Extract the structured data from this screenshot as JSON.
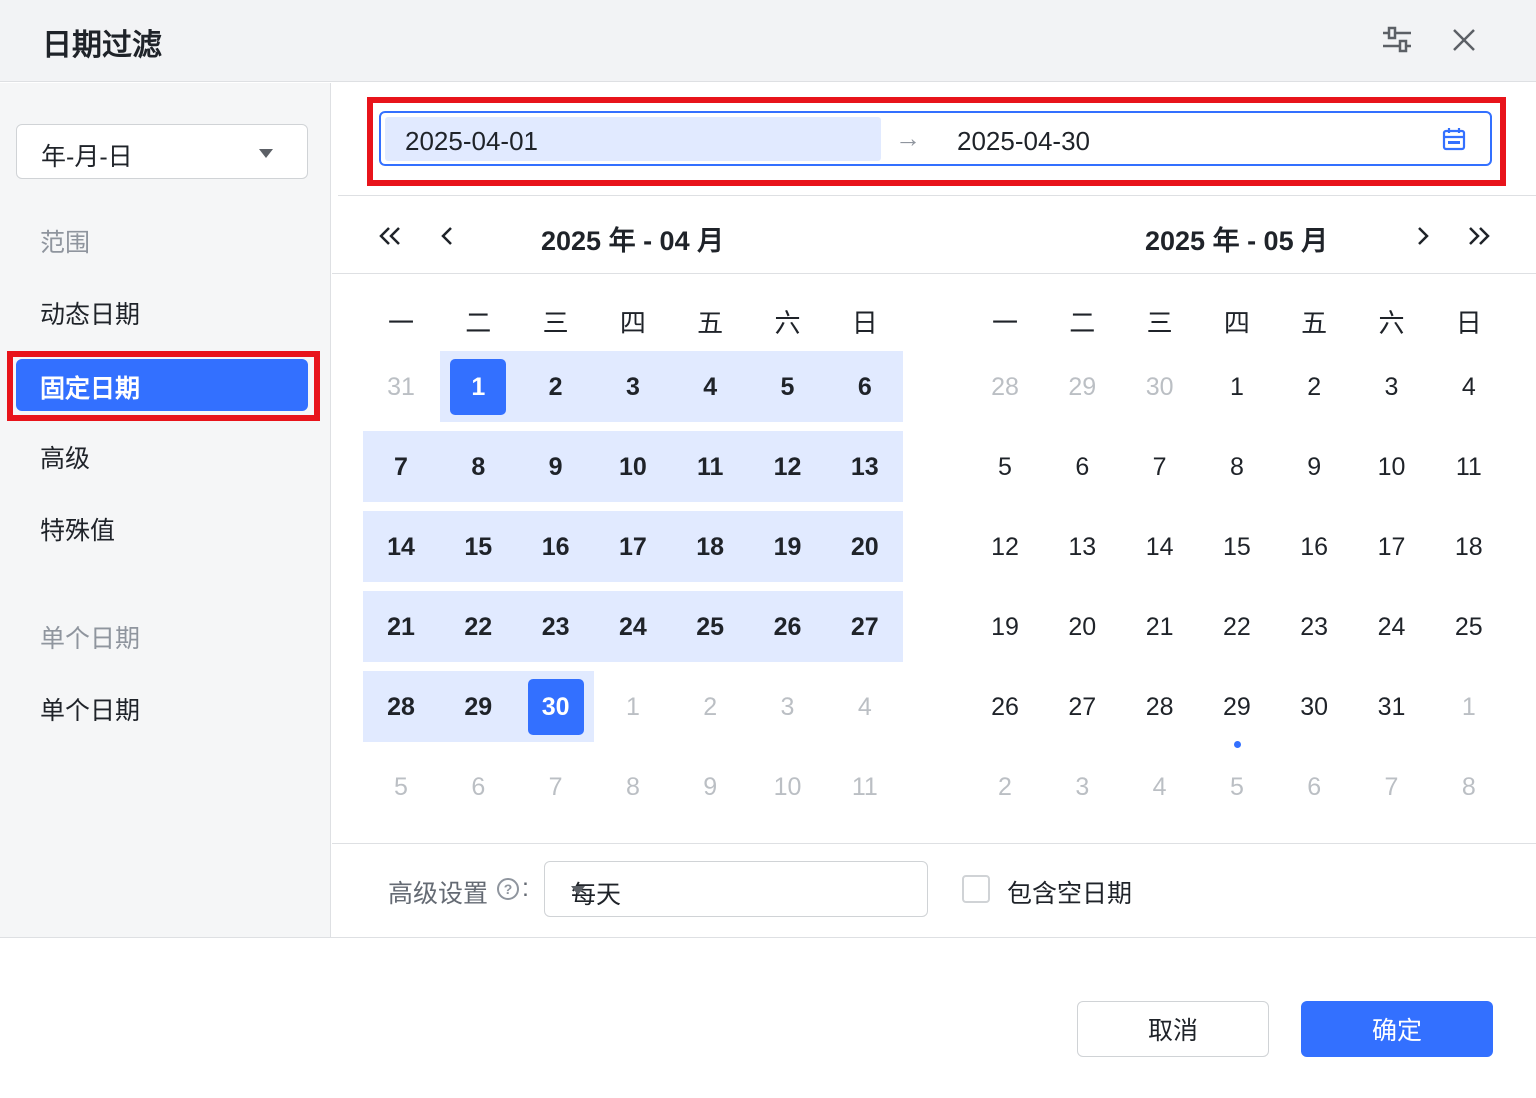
{
  "dialog": {
    "title": "日期过滤",
    "settings_icon": "sliders-icon",
    "close_icon": "close-icon"
  },
  "sidebar": {
    "format_select": "年-月-日",
    "groups": {
      "range": "范围",
      "single": "单个日期"
    },
    "items": {
      "dynamic": "动态日期",
      "fixed": "固定日期",
      "advanced": "高级",
      "special": "特殊值",
      "single_date": "单个日期"
    },
    "active_item": "固定日期"
  },
  "range": {
    "start": "2025-04-01",
    "separator": "→",
    "end": "2025-04-30",
    "icon": "calendar-icon"
  },
  "calendar": {
    "left_title": "2025 年 - 04 月",
    "right_title": "2025 年 - 05 月",
    "weekdays": [
      "一",
      "二",
      "三",
      "四",
      "五",
      "六",
      "日"
    ],
    "left_days": [
      [
        "31",
        "1",
        "2",
        "3",
        "4",
        "5",
        "6"
      ],
      [
        "7",
        "8",
        "9",
        "10",
        "11",
        "12",
        "13"
      ],
      [
        "14",
        "15",
        "16",
        "17",
        "18",
        "19",
        "20"
      ],
      [
        "21",
        "22",
        "23",
        "24",
        "25",
        "26",
        "27"
      ],
      [
        "28",
        "29",
        "30",
        "1",
        "2",
        "3",
        "4"
      ],
      [
        "5",
        "6",
        "7",
        "8",
        "9",
        "10",
        "11"
      ]
    ],
    "right_days": [
      [
        "28",
        "29",
        "30",
        "1",
        "2",
        "3",
        "4"
      ],
      [
        "5",
        "6",
        "7",
        "8",
        "9",
        "10",
        "11"
      ],
      [
        "12",
        "13",
        "14",
        "15",
        "16",
        "17",
        "18"
      ],
      [
        "19",
        "20",
        "21",
        "22",
        "23",
        "24",
        "25"
      ],
      [
        "26",
        "27",
        "28",
        "29",
        "30",
        "31",
        "1"
      ],
      [
        "2",
        "3",
        "4",
        "5",
        "6",
        "7",
        "8"
      ]
    ]
  },
  "advanced_settings": {
    "label": "高级设置",
    "help_icon": "?",
    "colon": ":",
    "frequency": "每天",
    "include_empty_label": "包含空日期",
    "include_empty_checked": false
  },
  "footer": {
    "cancel": "取消",
    "confirm": "确定"
  },
  "colors": {
    "accent": "#3370ff",
    "range_fill": "#e1eaff",
    "annotation": "#e8141b"
  }
}
